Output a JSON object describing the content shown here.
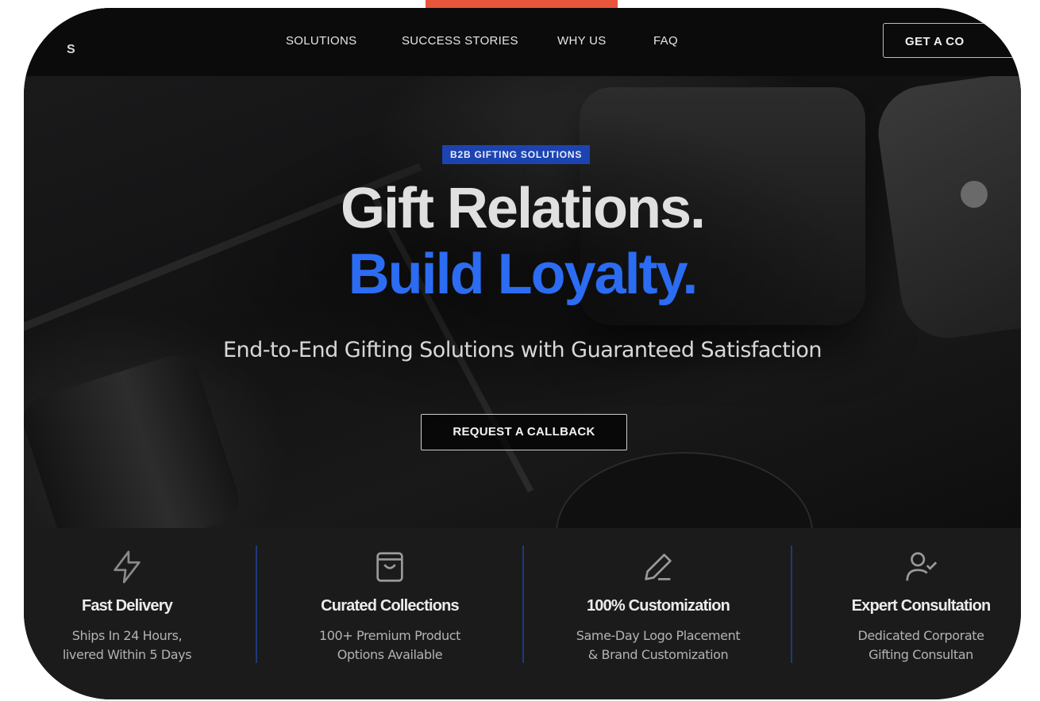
{
  "nav": {
    "logo_fragment": "S",
    "links": [
      "SOLUTIONS",
      "SUCCESS STORIES",
      "WHY US",
      "FAQ"
    ],
    "cta_label": "GET A CO"
  },
  "hero": {
    "badge": "B2B GIFTING SOLUTIONS",
    "headline_line1": "Gift Relations.",
    "headline_line2": "Build Loyalty.",
    "subtitle": "End-to-End Gifting Solutions with Guaranteed Satisfaction",
    "cta_label": "REQUEST A CALLBACK"
  },
  "features": [
    {
      "icon": "lightning-icon",
      "title": "Fast Delivery",
      "desc_line1": "Ships In 24 Hours,",
      "desc_line2": "livered Within 5 Days"
    },
    {
      "icon": "shopping-bag-icon",
      "title": "Curated Collections",
      "desc_line1": "100+ Premium Product",
      "desc_line2": "Options Available"
    },
    {
      "icon": "pen-icon",
      "title": "100% Customization",
      "desc_line1": "Same-Day Logo Placement",
      "desc_line2": "& Brand Customization"
    },
    {
      "icon": "user-check-icon",
      "title": "Expert Consultation",
      "desc_line1": "Dedicated Corporate",
      "desc_line2": "Gifting Consultan"
    }
  ],
  "colors": {
    "accent_orange": "#e8553a",
    "brand_blue": "#2b6cf2",
    "badge_blue": "#1c43b0"
  }
}
